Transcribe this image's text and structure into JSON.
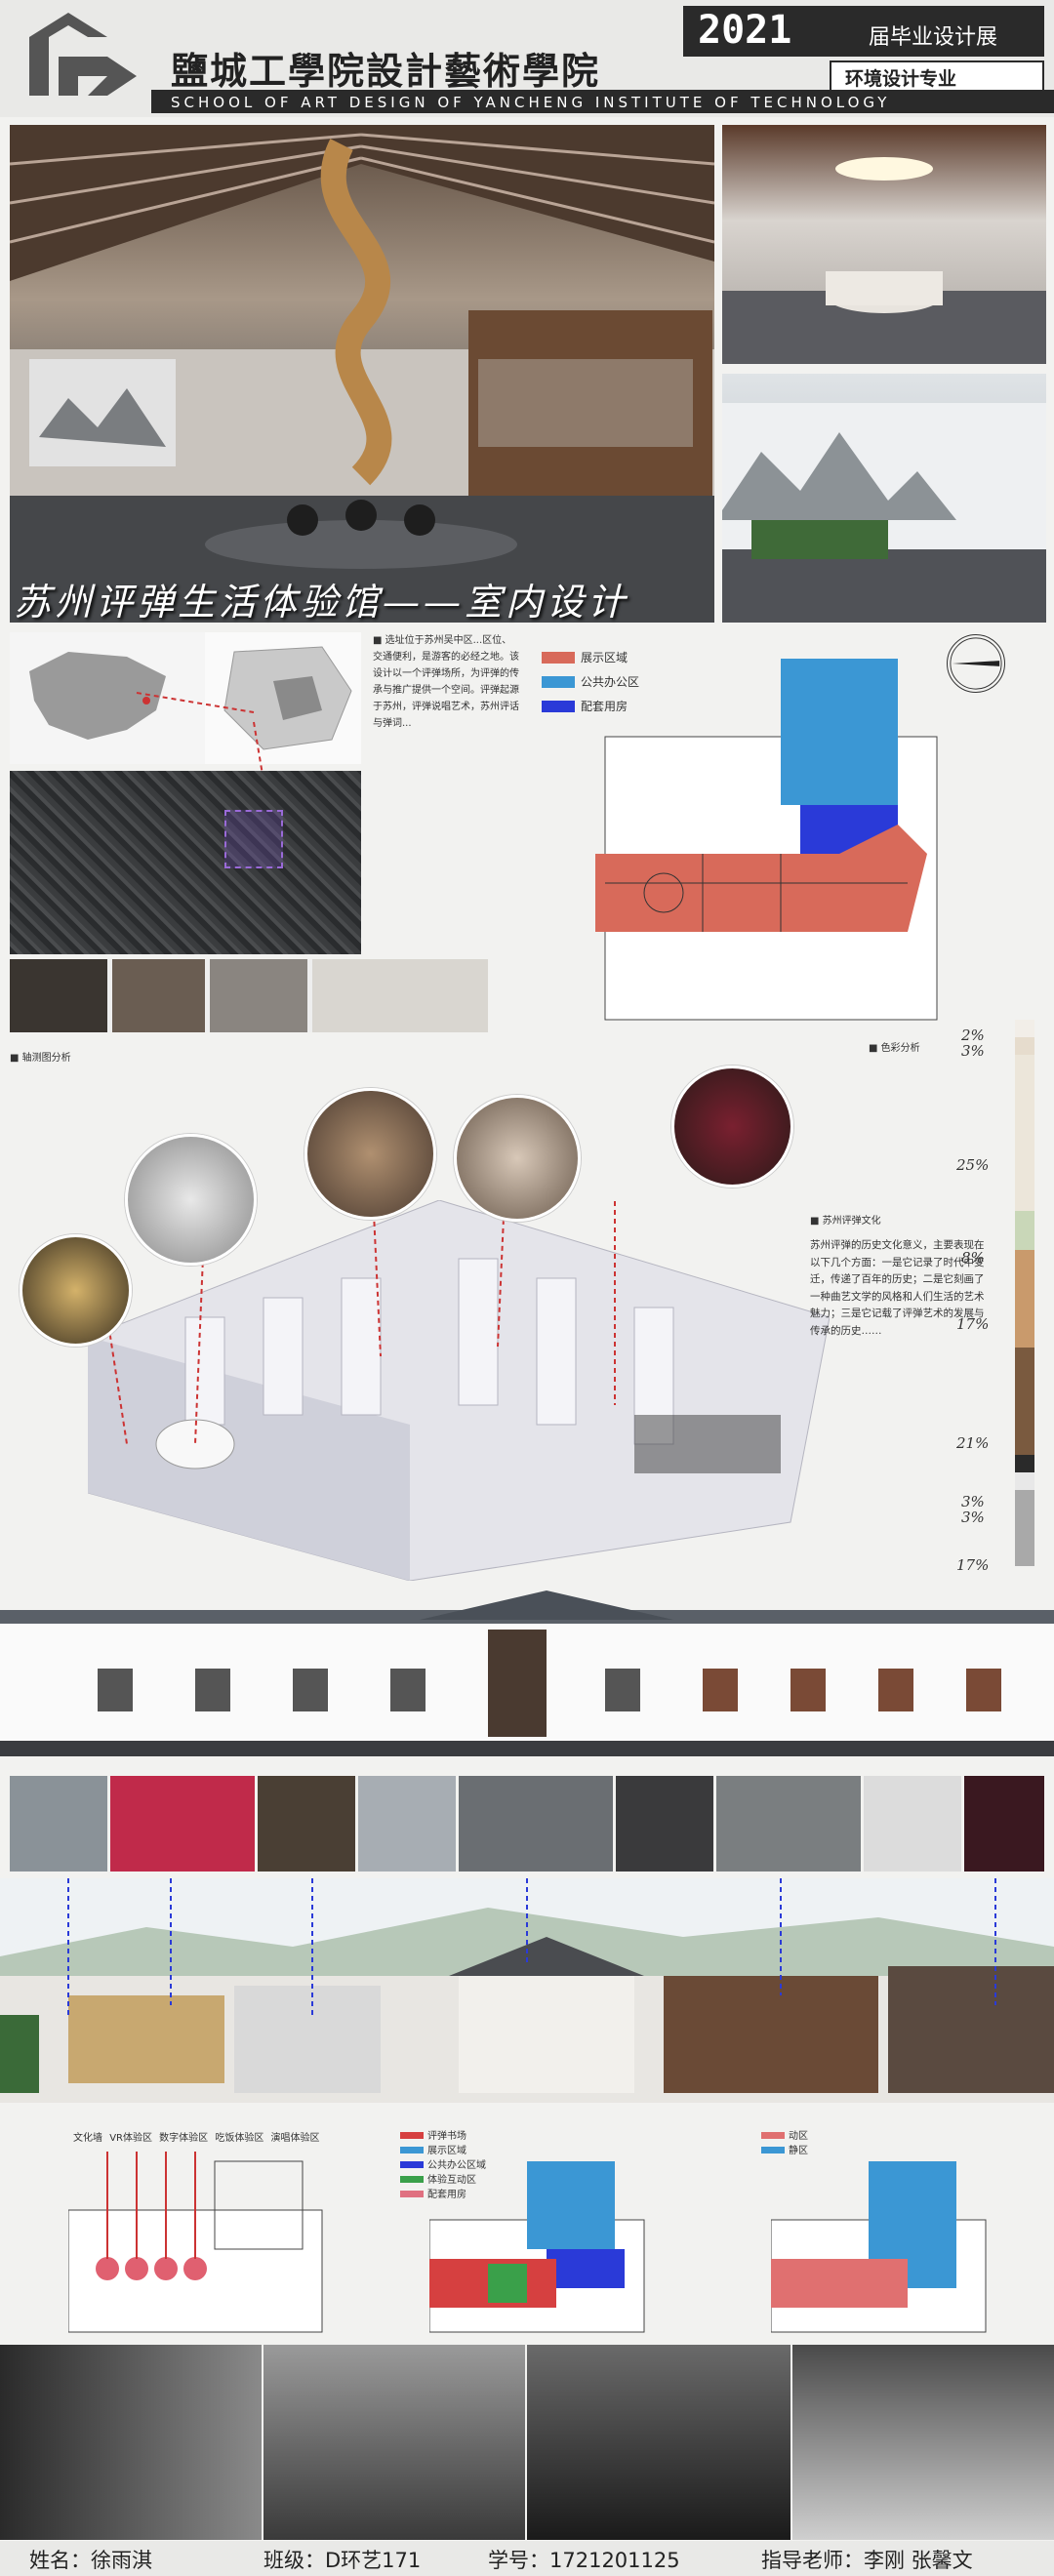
{
  "header": {
    "school_cn": "鹽城工學院設計藝術學院",
    "school_en": "SCHOOL OF ART DESIGN OF YANCHENG INSTITUTE OF TECHNOLOGY",
    "year": "2021",
    "expo": "届毕业设计展",
    "major": "环境设计专业"
  },
  "title": "苏州评弹生活体验馆——室内设计",
  "intro_text": "■ 选址位于苏州吴中区...区位、交通便利，是游客的必经之地。该设计以一个评弹场所，为评弹的传承与推广提供一个空间。评弹起源于苏州，评弹说唱艺术，苏州评话与弹词...",
  "plan_legend": [
    {
      "label": "展示区域",
      "color": "#d86a5a"
    },
    {
      "label": "公共办公区",
      "color": "#3b97d4"
    },
    {
      "label": "配套用房",
      "color": "#2a3ad8"
    }
  ],
  "labels": {
    "axon_label": "■ 轴测图分析",
    "color_label": "■ 色彩分析",
    "culture_label": "■ 苏州评弹文化"
  },
  "culture_text": "苏州评弹的历史文化意义，主要表现在以下几个方面：一是它记录了时代中变迁，传递了百年的历史；二是它刻画了一种曲艺文学的风格和人们生活的艺术魅力；三是它记载了评弹艺术的发展与传承的历史……",
  "color_swatches": [
    {
      "pct": "2%",
      "color": "#f2eee8"
    },
    {
      "pct": "3%",
      "color": "#e6dccd"
    },
    {
      "pct": "25%",
      "color": "#ece6da"
    },
    {
      "pct": "8%",
      "color": "#c9d7b8"
    },
    {
      "pct": "17%",
      "color": "#c99a6c"
    },
    {
      "pct": "21%",
      "color": "#7a5a3f"
    },
    {
      "pct": "3%",
      "color": "#2a2a2a"
    },
    {
      "pct": "3%",
      "color": "#e8e8e8"
    },
    {
      "pct": "17%",
      "color": "#a9a9a9"
    }
  ],
  "plan2_legend": [
    {
      "label": "评弹书场",
      "color": "#d64040"
    },
    {
      "label": "展示区域",
      "color": "#3b97d4"
    },
    {
      "label": "公共办公区域",
      "color": "#2a3ad8"
    },
    {
      "label": "体验互动区",
      "color": "#3aa04a"
    },
    {
      "label": "配套用房",
      "color": "#e07080"
    }
  ],
  "plan3_legend": [
    {
      "label": "动区",
      "color": "#e07070"
    },
    {
      "label": "静区",
      "color": "#3b97d4"
    }
  ],
  "plan1_labels": [
    "文化墙",
    "VR体验区",
    "数字体验区",
    "吃饭体验区",
    "演唱体验区"
  ],
  "footer": {
    "name": "姓名：徐雨淇",
    "class": "班级：D环艺171",
    "id": "学号：1721201125",
    "teacher": "指导老师：李刚 张馨文"
  }
}
